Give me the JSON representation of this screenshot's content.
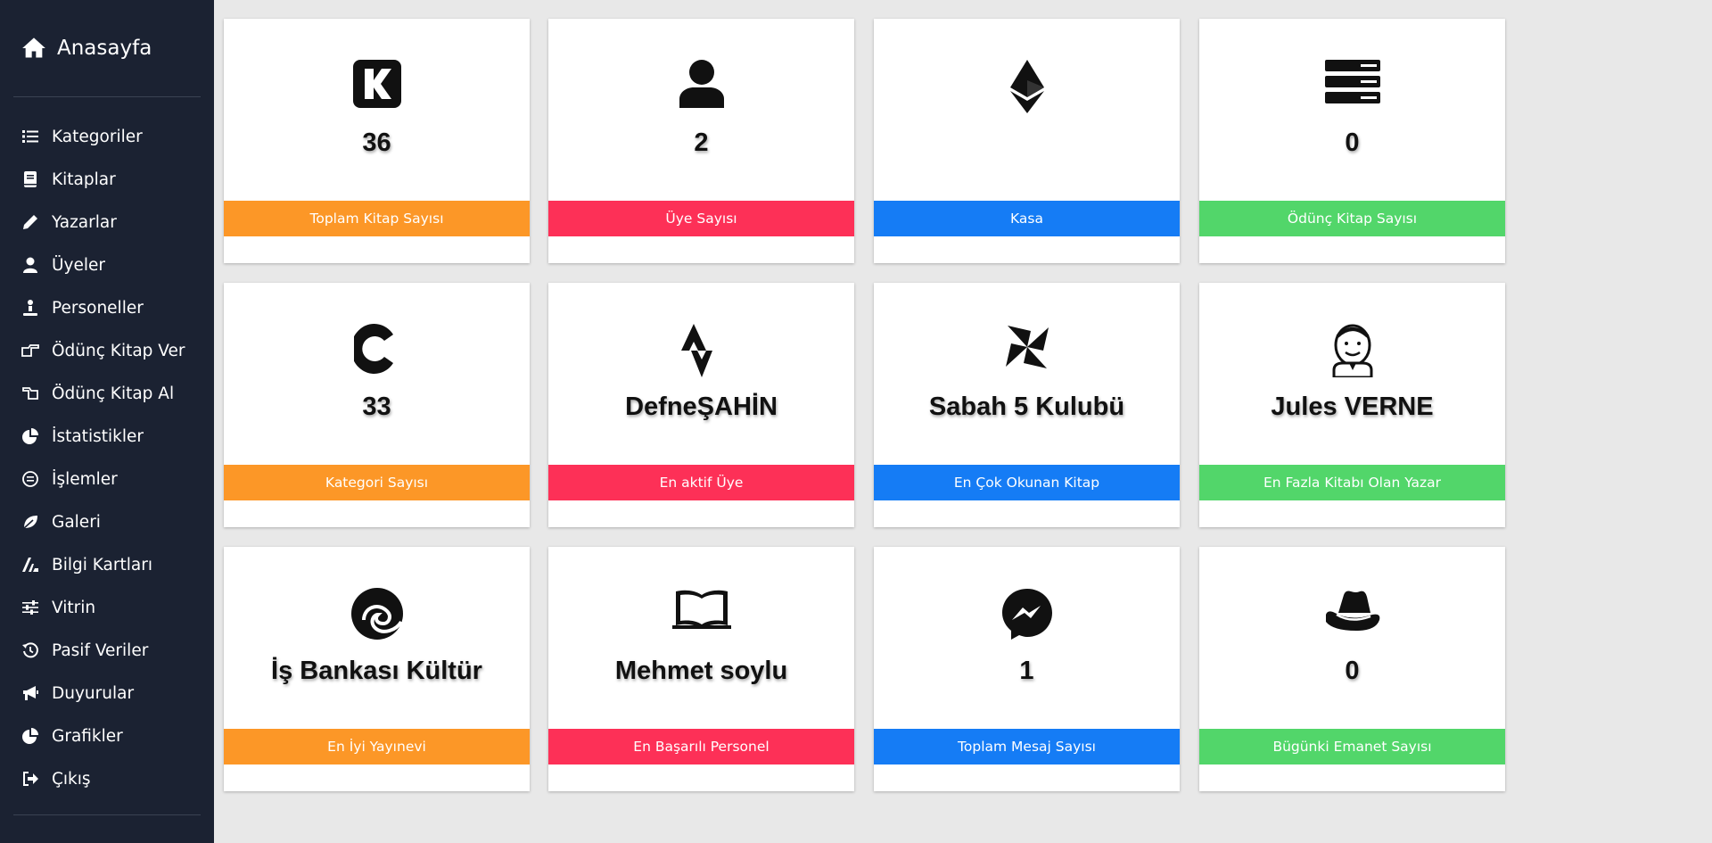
{
  "sidebar": {
    "brand": {
      "label": "Anasayfa",
      "icon": "home-icon"
    },
    "items": [
      {
        "label": "Kategoriler",
        "icon": "list-icon"
      },
      {
        "label": "Kitaplar",
        "icon": "book-icon"
      },
      {
        "label": "Yazarlar",
        "icon": "pencil-icon"
      },
      {
        "label": "Üyeler",
        "icon": "user-icon"
      },
      {
        "label": "Personeller",
        "icon": "staff-icon"
      },
      {
        "label": "Ödünç Kitap Ver",
        "icon": "hand-point-right-icon"
      },
      {
        "label": "Ödünç Kitap Al",
        "icon": "hand-point-left-icon"
      },
      {
        "label": "İstatistikler",
        "icon": "pie-chart-icon"
      },
      {
        "label": "İşlemler",
        "icon": "circle-list-icon"
      },
      {
        "label": "Galeri",
        "icon": "leaf-icon"
      },
      {
        "label": "Bilgi Kartları",
        "icon": "cards-icon"
      },
      {
        "label": "Vitrin",
        "icon": "sliders-icon"
      },
      {
        "label": "Pasif Veriler",
        "icon": "history-icon"
      },
      {
        "label": "Duyurular",
        "icon": "megaphone-icon"
      },
      {
        "label": "Grafikler",
        "icon": "pie-chart-icon"
      },
      {
        "label": "Çıkış",
        "icon": "sign-out-icon"
      }
    ]
  },
  "colors": {
    "orange": "#fc9727",
    "pink": "#fd3057",
    "blue": "#157cf5",
    "green": "#52d66a",
    "sidebar": "#1b2232"
  },
  "cards": [
    {
      "value": "36",
      "label": "Toplam Kitap Sayısı",
      "icon": "k-logo-icon"
    },
    {
      "value": "2",
      "label": "Üye Sayısı",
      "icon": "user-icon"
    },
    {
      "value": "",
      "label": "Kasa",
      "icon": "ethereum-icon"
    },
    {
      "value": "0",
      "label": "Ödünç Kitap Sayısı",
      "icon": "server-icon"
    },
    {
      "value": "33",
      "label": "Kategori Sayısı",
      "icon": "c-logo-icon"
    },
    {
      "value": "DefneŞAHİN",
      "label": "En aktif Üye",
      "icon": "strava-icon"
    },
    {
      "value": "Sabah 5 Kulubü",
      "label": "En Çok Okunan Kitap",
      "icon": "pinwheel-icon"
    },
    {
      "value": "Jules VERNE",
      "label": "En Fazla Kitabı Olan Yazar",
      "icon": "jenkins-icon"
    },
    {
      "value": "İş Bankası Kültür",
      "label": "En İyi Yayınevi",
      "icon": "edge-icon"
    },
    {
      "value": "Mehmet soylu",
      "label": "En Başarılı Personel",
      "icon": "open-book-icon"
    },
    {
      "value": "1",
      "label": "Toplam Mesaj Sayısı",
      "icon": "messenger-icon"
    },
    {
      "value": "0",
      "label": "Bügünki Emanet Sayısı",
      "icon": "redhat-icon"
    }
  ]
}
